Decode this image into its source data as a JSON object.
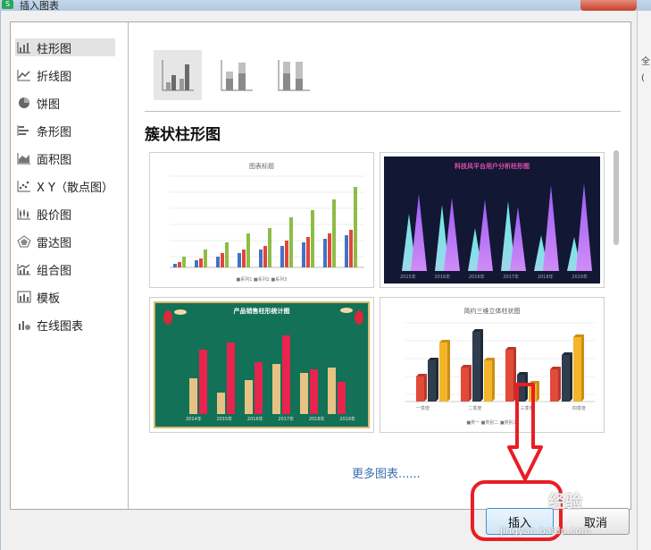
{
  "window": {
    "title": "插入图表",
    "app_icon_letter": "S"
  },
  "sidebar": {
    "items": [
      {
        "label": "柱形图",
        "icon": "column-chart-icon"
      },
      {
        "label": "折线图",
        "icon": "line-chart-icon"
      },
      {
        "label": "饼图",
        "icon": "pie-chart-icon"
      },
      {
        "label": "条形图",
        "icon": "bar-chart-icon"
      },
      {
        "label": "面积图",
        "icon": "area-chart-icon"
      },
      {
        "label": "X Y（散点图）",
        "icon": "scatter-chart-icon"
      },
      {
        "label": "股价图",
        "icon": "stock-chart-icon"
      },
      {
        "label": "雷达图",
        "icon": "radar-chart-icon"
      },
      {
        "label": "组合图",
        "icon": "combo-chart-icon"
      },
      {
        "label": "模板",
        "icon": "template-icon"
      },
      {
        "label": "在线图表",
        "icon": "online-chart-icon"
      }
    ],
    "selected_index": 0
  },
  "subtypes": [
    "clustered-column-icon",
    "stacked-column-icon",
    "percent-stacked-column-icon"
  ],
  "section_title": "簇状柱形图",
  "thumbnails": [
    {
      "title": "图表标题",
      "legend": "■系列1 ■系列2 ■系列3",
      "bg": "#ffffff"
    },
    {
      "title": "科技风平台用户分析柱形图",
      "labels": [
        "2015年",
        "2016年",
        "2016年",
        "2017年",
        "2018年",
        "2019年"
      ],
      "bg": "#121733"
    },
    {
      "title": "产品销售柱形统计图",
      "labels": [
        "2014年",
        "2015年",
        "2016年",
        "2017年",
        "2018年",
        "2019年"
      ],
      "bg": "#127156"
    },
    {
      "title": "简约三维立体柱状图",
      "labels": [
        "一季度",
        "二季度",
        "三季度",
        "四季度"
      ],
      "legend": "■类一 ■类别二 ■类别三",
      "bg": "#ffffff"
    }
  ],
  "more_link": "更多图表......",
  "buttons": {
    "insert": "插入",
    "cancel": "取消"
  },
  "watermark": {
    "line1": "经验",
    "line2": "jingyan.baidu.com"
  },
  "right_strip": {
    "chars": [
      "全",
      "("
    ]
  },
  "colors": {
    "accent_blue": "#3d6fb0",
    "highlight_red": "#e81e24",
    "thumb_dark": "#121733",
    "thumb_green": "#127156"
  }
}
